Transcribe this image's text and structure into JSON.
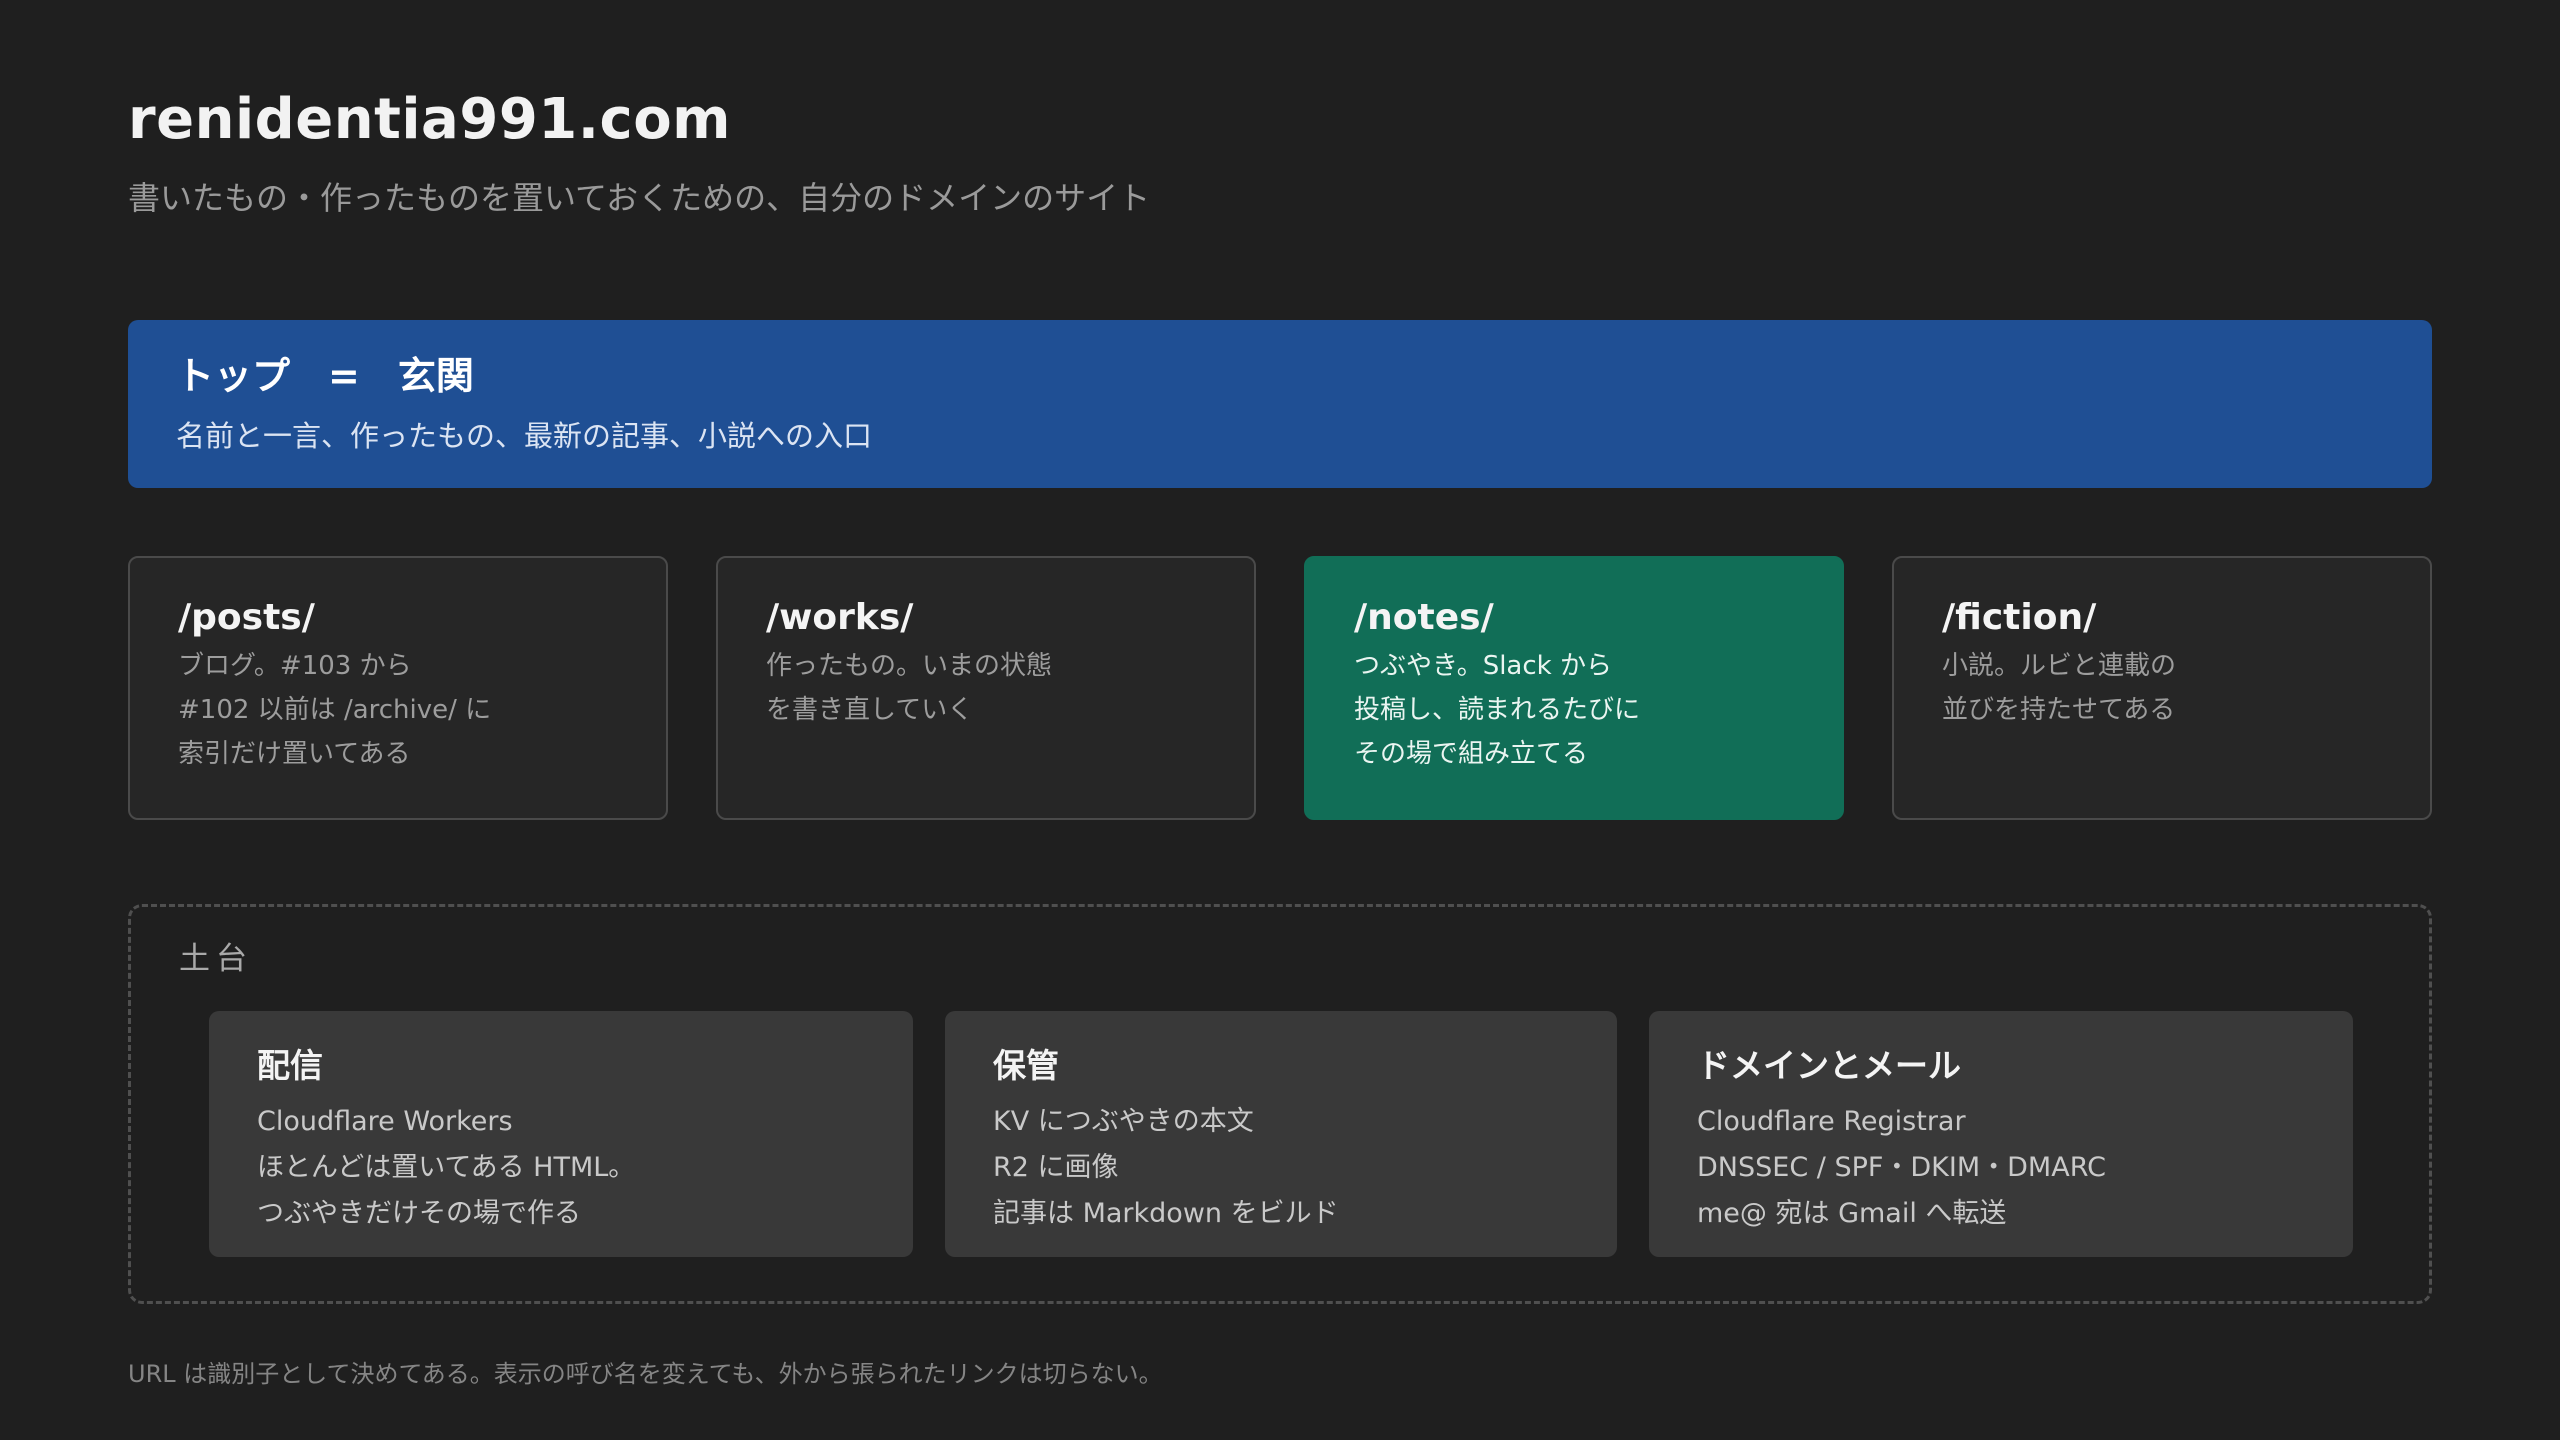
{
  "header": {
    "title": "renidentia991.com",
    "subtitle": "書いたもの・作ったものを置いておくための、自分のドメインのサイト"
  },
  "top": {
    "title": "トップ　=　玄関",
    "description": "名前と一言、作ったもの、最新の記事、小説への入口"
  },
  "sections": [
    {
      "path": "/posts/",
      "lines": [
        "ブログ。#103 から",
        "#102 以前は /archive/ に",
        "索引だけ置いてある"
      ],
      "active": false
    },
    {
      "path": "/works/",
      "lines": [
        "作ったもの。いまの状態",
        "を書き直していく"
      ],
      "active": false
    },
    {
      "path": "/notes/",
      "lines": [
        "つぶやき。Slack から",
        "投稿し、読まれるたびに",
        "その場で組み立てる"
      ],
      "active": true
    },
    {
      "path": "/fiction/",
      "lines": [
        "小説。ルビと連載の",
        "並びを持たせてある"
      ],
      "active": false
    }
  ],
  "foundation": {
    "label": "土台",
    "items": [
      {
        "title": "配信",
        "lines": [
          "Cloudflare Workers",
          "ほとんどは置いてある HTML。",
          "つぶやきだけその場で作る"
        ]
      },
      {
        "title": "保管",
        "lines": [
          "KV につぶやきの本文",
          "R2 に画像",
          "記事は Markdown をビルド"
        ]
      },
      {
        "title": "ドメインとメール",
        "lines": [
          "Cloudflare Registrar",
          "DNSSEC / SPF・DKIM・DMARC",
          "me@ 宛は Gmail へ転送"
        ]
      }
    ]
  },
  "footer": {
    "note": "URL は識別子として決めてある。表示の呼び名を変えても、外から張られたリンクは切らない。"
  },
  "colors": {
    "background": "#1f1f1f",
    "top_banner": "#1f4f94",
    "active_card": "#116e57",
    "card_border": "#4a4a4a",
    "infra_card": "#393939"
  }
}
